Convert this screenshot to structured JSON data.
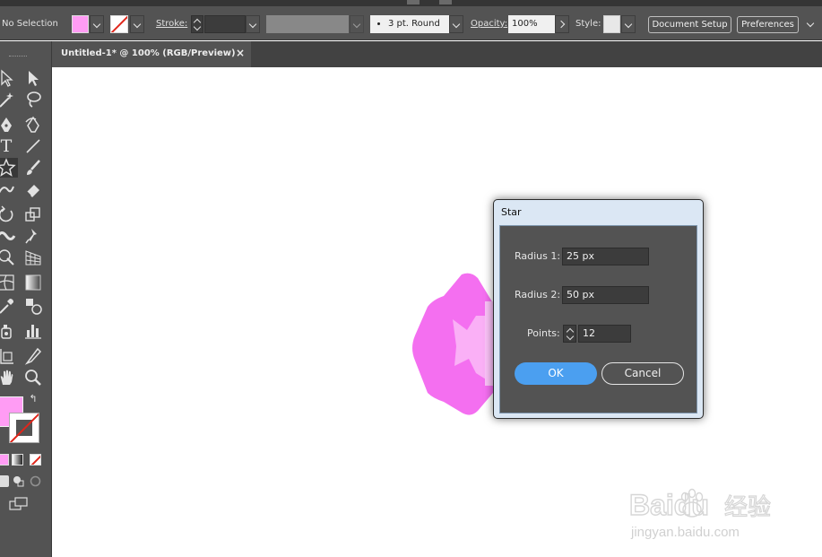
{
  "app": {
    "accent": "#4b9ff0",
    "panel": "#535353"
  },
  "control_bar": {
    "selection_label": "No Selection",
    "fill_color": "#ff9cf4",
    "stroke_label": "Stroke:",
    "stroke_weight": "",
    "stroke_profile": "3 pt. Round",
    "opacity_label": "Opacity:",
    "opacity_value": "100%",
    "style_label": "Style:",
    "document_setup": "Document Setup",
    "preferences": "Preferences"
  },
  "document_tab": {
    "title": "Untitled-1* @ 100% (RGB/Preview)",
    "close": "×"
  },
  "toolbar": {
    "tools": [
      "selection-tool",
      "direct-selection-tool",
      "magic-wand-tool",
      "lasso-tool",
      "pen-tool",
      "curvature-tool",
      "type-tool",
      "line-segment-tool",
      "star-tool",
      "paintbrush-tool",
      "shaper-tool",
      "eraser-tool",
      "rotate-tool",
      "scale-tool",
      "width-tool",
      "puppet-warp-tool",
      "shape-builder-tool",
      "perspective-grid-tool",
      "mesh-tool",
      "gradient-tool",
      "eyedropper-tool",
      "blend-tool",
      "symbol-sprayer-tool",
      "column-graph-tool",
      "artboard-tool",
      "slice-tool",
      "hand-tool",
      "zoom-tool"
    ],
    "active_tool": "star-tool",
    "fill_color": "#ff9cf4"
  },
  "star_dialog": {
    "title": "Star",
    "radius1_label": "Radius 1:",
    "radius1_value": "25 px",
    "radius2_label": "Radius 2:",
    "radius2_value": "50 px",
    "points_label": "Points:",
    "points_value": "12",
    "ok": "OK",
    "cancel": "Cancel"
  },
  "artwork": {
    "star_color": "#f46ff0",
    "inner_color": "#fab0f6"
  },
  "watermark": {
    "brand": "Baidu",
    "cn": "经验",
    "url": "jingyan.baidu.com"
  }
}
